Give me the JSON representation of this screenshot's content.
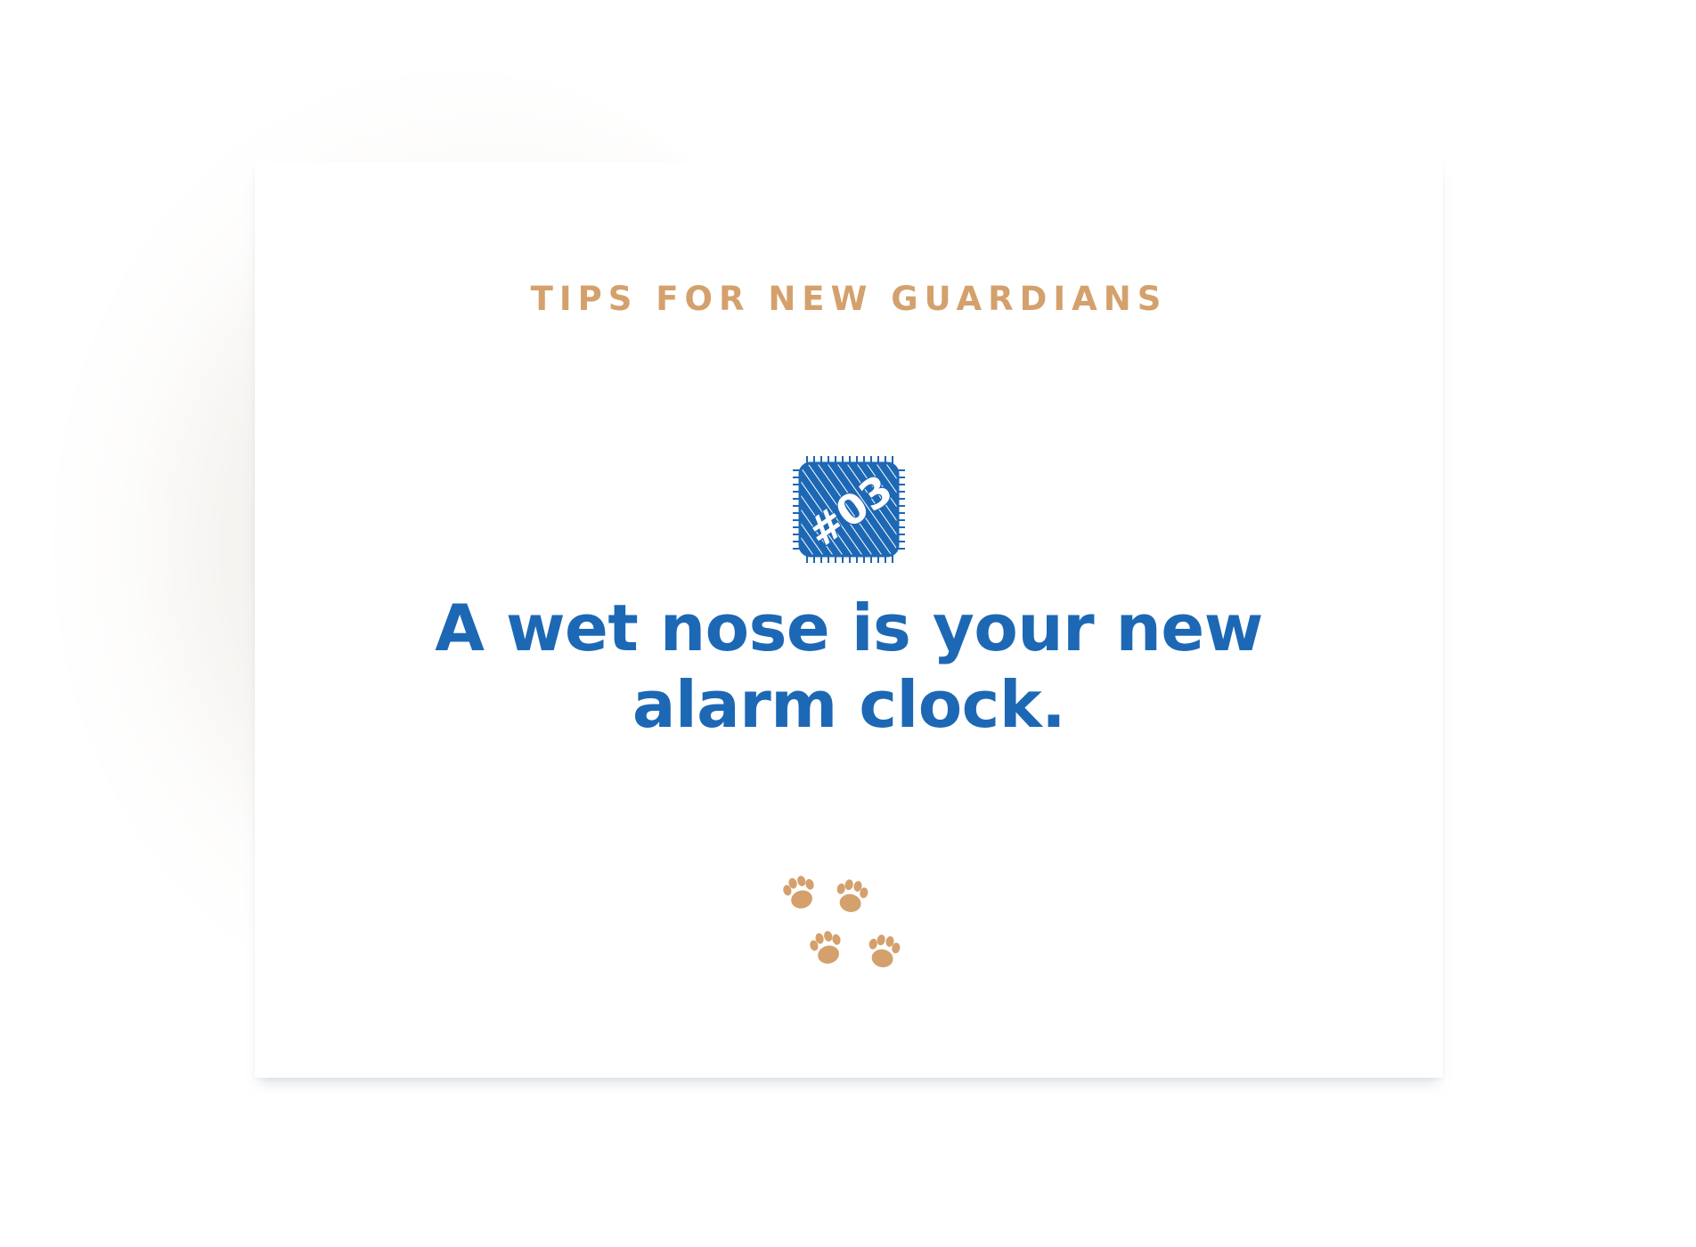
{
  "eyebrow": "TIPS FOR NEW GUARDIANS",
  "badge": {
    "number": "#03",
    "color": "#1d68b5"
  },
  "headline": {
    "line1": "A wet nose is your new",
    "line2": "alarm clock."
  },
  "colors": {
    "accent_tan": "#d4a06c",
    "primary_blue": "#1d68b5",
    "background": "#ffffff"
  },
  "decoration": {
    "icon": "paw-prints-icon",
    "count": 4
  }
}
